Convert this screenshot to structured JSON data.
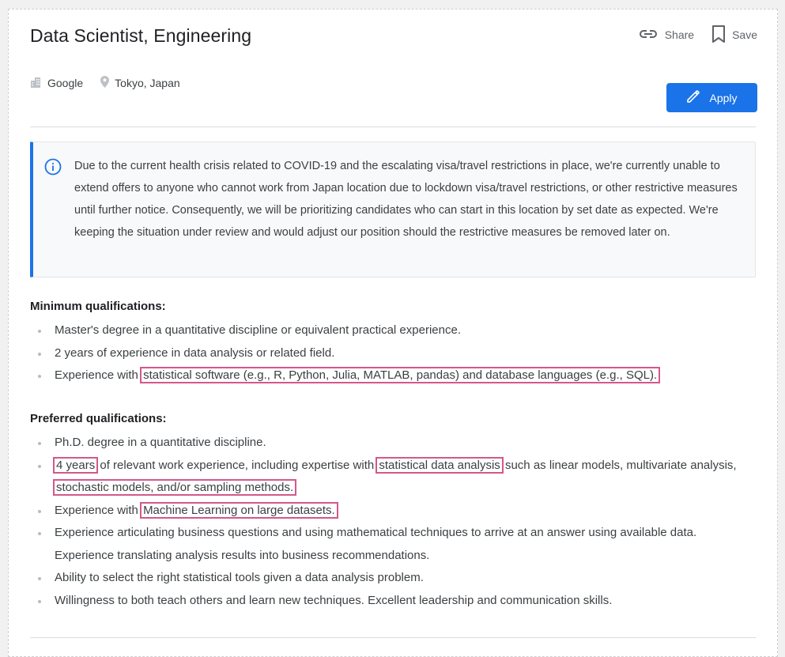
{
  "job": {
    "title": "Data Scientist, Engineering",
    "company": "Google",
    "location": "Tokyo, Japan"
  },
  "actions": {
    "share_label": "Share",
    "save_label": "Save",
    "apply_label": "Apply"
  },
  "notice": {
    "text": "Due to the current health crisis related to COVID-19 and the escalating visa/travel restrictions in place, we're currently unable to extend offers to anyone who cannot work from Japan location due to lockdown visa/travel restrictions, or other restrictive measures until further notice. Consequently, we will be prioritizing candidates who can start in this location by set date as expected. We're keeping the situation under review and would adjust our position should the restrictive measures be removed later on."
  },
  "minimum": {
    "title": "Minimum qualifications:",
    "items": [
      "Master's degree in a quantitative discipline or equivalent practical experience.",
      "2 years of experience in data analysis or related field.",
      {
        "pre": "Experience with ",
        "hl": "statistical software (e.g., R, Python, Julia, MATLAB, pandas) and database languages (e.g., SQL)."
      }
    ]
  },
  "preferred": {
    "title": "Preferred qualifications:",
    "items": {
      "i0": "Ph.D. degree in a quantitative discipline.",
      "i1_hl1": "4 years",
      "i1_mid1": " of relevant work experience, including expertise with ",
      "i1_hl2": "statistical data analysis",
      "i1_mid2": " such as linear models, multivariate analysis, ",
      "i1_hl3": "stochastic models, and/or sampling methods.",
      "i2_pre": "Experience with ",
      "i2_hl": "Machine Learning on large datasets.",
      "i3": "Experience articulating business questions and using mathematical techniques to arrive at an answer using available data. Experience translating analysis results into business recommendations.",
      "i4": "Ability to select the right statistical tools given a data analysis problem.",
      "i5": "Willingness to both teach others and learn new techniques. Excellent leadership and communication skills."
    }
  },
  "colors": {
    "accent": "#1a73e8",
    "highlight_box": "#d3588a"
  },
  "icons": [
    "building-icon",
    "location-pin-icon",
    "link-icon",
    "bookmark-icon",
    "pencil-icon",
    "info-icon"
  ]
}
